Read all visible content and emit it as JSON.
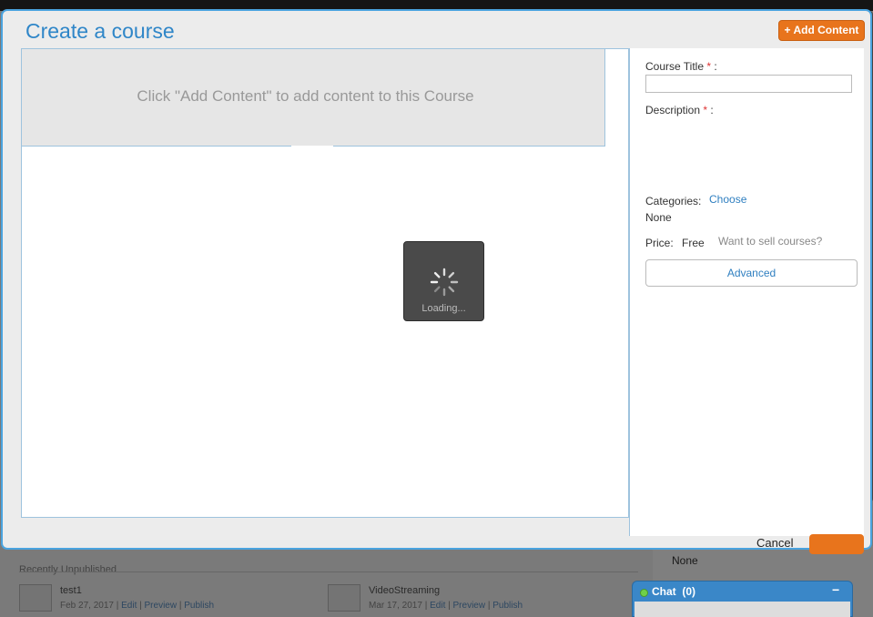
{
  "modal": {
    "title": "Create a course",
    "add_content_label": "+ Add Content",
    "hint": "Click \"Add Content\" to add content to this Course",
    "loading": "Loading...",
    "cancel_label": "Cancel"
  },
  "form": {
    "course_title_label": "Course Title",
    "course_title_value": "",
    "description_label": "Description",
    "required_mark": "*",
    "colon": ":",
    "categories_label": "Categories:",
    "categories_choose": "Choose",
    "categories_value": "None",
    "price_label": "Price:",
    "price_value": "Free",
    "sell_link": "Want to sell courses?",
    "advanced_label": "Advanced"
  },
  "background": {
    "section_title": "Recently Unpublished",
    "right_none": "None",
    "items": [
      {
        "title": "test1",
        "date": "Feb 27, 2017",
        "edit": "Edit",
        "preview": "Preview",
        "publish": "Publish",
        "sep": "|"
      },
      {
        "title": "VideoStreaming",
        "date": "Mar 17, 2017",
        "edit": "Edit",
        "preview": "Preview",
        "publish": "Publish",
        "sep": "|"
      }
    ]
  },
  "chat": {
    "label": "Chat",
    "count": "(0)",
    "minimize": "−"
  },
  "colors": {
    "accent_blue": "#2f86c8",
    "button_orange": "#e8741c",
    "chat_online": "#6fd04a"
  }
}
